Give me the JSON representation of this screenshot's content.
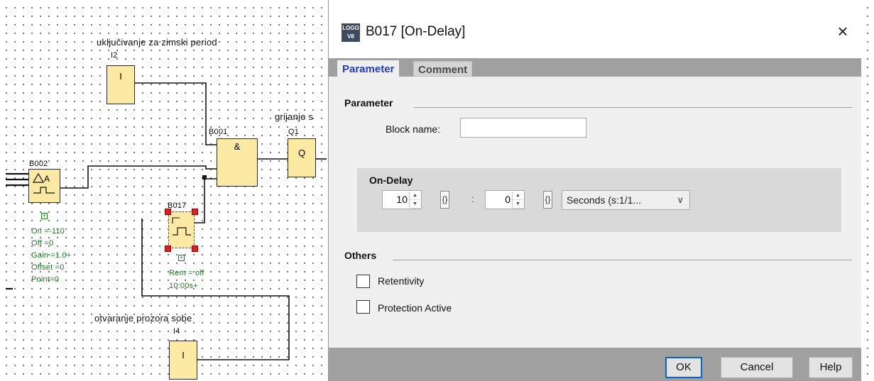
{
  "canvas": {
    "labels": {
      "i2_caption": "uključivanje za zimski period",
      "i2_name": "I2",
      "b001_name": "B001",
      "q1_caption": "grijanje s",
      "q1_name": "Q1",
      "b002_name": "B002",
      "b017_name": "B017",
      "i4_caption": "otvaranje prozora sobe",
      "i4_name": "I4"
    },
    "blocks": {
      "i2_symbol": "I",
      "b001_symbol": "&",
      "q1_symbol": "Q",
      "i4_symbol": "I"
    },
    "b002_params": [
      "On    =-110",
      "Off   =0",
      "Gain  =1.0+",
      "Offset =0",
      "Point=0"
    ],
    "b017_params": [
      "Rem = off",
      "10:00s+"
    ]
  },
  "dialog": {
    "app_icon_text": "LOGO",
    "app_icon_sub": "V8",
    "title": "B017 [On-Delay]",
    "close_symbol": "×",
    "tabs": [
      "Parameter",
      "Comment"
    ],
    "parameter_section": {
      "title": "Parameter",
      "block_name_label": "Block name:",
      "block_name_value": ""
    },
    "ondelay_section": {
      "title": "On-Delay",
      "value_1": "10",
      "separator": ":",
      "value_2": "0",
      "param_button": "{}",
      "units": "Seconds (s:1/1...",
      "units_chevron": "∨"
    },
    "others_section": {
      "title": "Others",
      "retentivity_label": "Retentivity",
      "retentivity_checked": false,
      "protection_label": "Protection Active",
      "protection_checked": false
    },
    "buttons": {
      "ok": "OK",
      "cancel": "Cancel",
      "help": "Help"
    }
  }
}
